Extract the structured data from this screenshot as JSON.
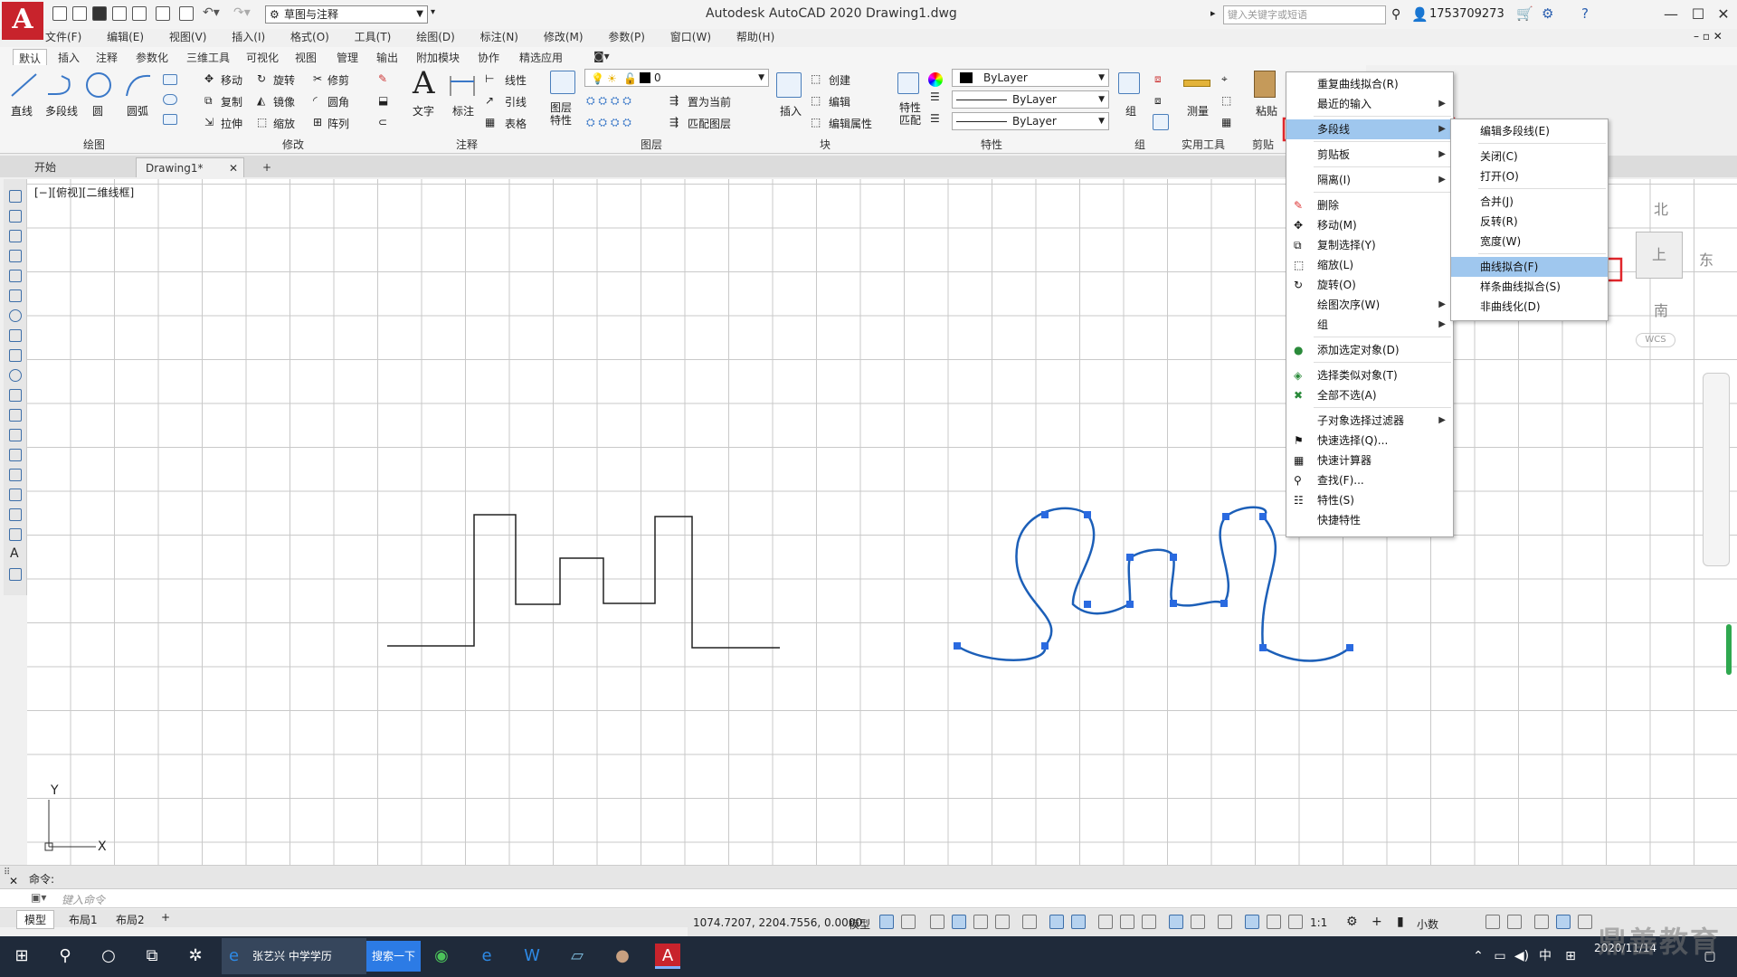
{
  "titlebar": {
    "logo": "A",
    "workspace": "草图与注释",
    "title": "Autodesk AutoCAD 2020    Drawing1.dwg",
    "search_placeholder": "键入关键字或短语",
    "user": "1753709273",
    "minimize": "—",
    "restore": "☐",
    "close": "✕"
  },
  "menubar": [
    "文件(F)",
    "编辑(E)",
    "视图(V)",
    "插入(I)",
    "格式(O)",
    "工具(T)",
    "绘图(D)",
    "标注(N)",
    "修改(M)",
    "参数(P)",
    "窗口(W)",
    "帮助(H)"
  ],
  "ribbon_tabs": [
    "默认",
    "插入",
    "注释",
    "参数化",
    "三维工具",
    "可视化",
    "视图",
    "管理",
    "输出",
    "附加模块",
    "协作",
    "精选应用"
  ],
  "ribbon": {
    "draw": {
      "title": "绘图",
      "line": "直线",
      "polyline": "多段线",
      "circle": "圆",
      "arc": "圆弧"
    },
    "modify": {
      "title": "修改",
      "move": "移动",
      "rotate": "旋转",
      "trim": "修剪",
      "copy": "复制",
      "mirror": "镜像",
      "fillet": "圆角",
      "stretch": "拉伸",
      "scale": "缩放",
      "array": "阵列"
    },
    "annotation": {
      "title": "注释",
      "text": "文字",
      "dimension": "标注",
      "linear": "线性",
      "leader": "引线",
      "table": "表格"
    },
    "layers": {
      "title": "图层",
      "layer_props": "图层\n特性",
      "layer_name": "0",
      "set_current": "置为当前",
      "match_layer": "匹配图层"
    },
    "block": {
      "title": "块",
      "insert": "插入",
      "create": "创建",
      "edit": "编辑",
      "edit_attr": "编辑属性"
    },
    "properties": {
      "title": "特性",
      "match": "特性\n匹配",
      "color": "ByLayer",
      "linetype": "ByLayer",
      "lineweight": "ByLayer"
    },
    "groups": {
      "title": "组",
      "group": "组"
    },
    "utilities": {
      "title": "实用工具",
      "measure": "测量"
    },
    "clipboard": {
      "title": "剪贴",
      "paste": "粘贴"
    }
  },
  "file_tabs": {
    "start": "开始",
    "drawing": "Drawing1*",
    "close": "✕",
    "add": "+"
  },
  "viewport_label": "[−][俯视][二维线框]",
  "ucs": {
    "y": "Y",
    "x": "X"
  },
  "viewcube": {
    "north": "北",
    "east": "东",
    "south": "南",
    "top": "上",
    "wcs": "WCS"
  },
  "context_menu": {
    "items": [
      {
        "label": "重复曲线拟合(R)"
      },
      {
        "label": "最近的输入",
        "sub": true
      },
      {
        "label": "多段线",
        "sub": true,
        "highlight": true
      },
      {
        "label": "剪贴板",
        "sub": true
      },
      {
        "label": "隔离(I)",
        "sub": true
      },
      {
        "label": "删除"
      },
      {
        "label": "移动(M)"
      },
      {
        "label": "复制选择(Y)"
      },
      {
        "label": "缩放(L)"
      },
      {
        "label": "旋转(O)"
      },
      {
        "label": "绘图次序(W)",
        "sub": true
      },
      {
        "label": "组",
        "sub": true
      },
      {
        "label": "添加选定对象(D)"
      },
      {
        "label": "选择类似对象(T)"
      },
      {
        "label": "全部不选(A)"
      },
      {
        "label": "子对象选择过滤器",
        "sub": true
      },
      {
        "label": "快速选择(Q)..."
      },
      {
        "label": "快速计算器"
      },
      {
        "label": "查找(F)..."
      },
      {
        "label": "特性(S)"
      },
      {
        "label": "快捷特性"
      }
    ]
  },
  "submenu": {
    "items": [
      {
        "label": "编辑多段线(E)"
      },
      {
        "label": "关闭(C)"
      },
      {
        "label": "打开(O)"
      },
      {
        "label": "合并(J)"
      },
      {
        "label": "反转(R)"
      },
      {
        "label": "宽度(W)"
      },
      {
        "label": "曲线拟合(F)",
        "highlight": true
      },
      {
        "label": "样条曲线拟合(S)"
      },
      {
        "label": "非曲线化(D)"
      }
    ]
  },
  "command": {
    "history": "命令:",
    "placeholder": "键入命令"
  },
  "layout_tabs": [
    "模型",
    "布局1",
    "布局2",
    "+"
  ],
  "status": {
    "coords": "1074.7207, 2204.7556, 0.0000",
    "model": "模型",
    "scale": "1:1",
    "units": "小数"
  },
  "taskbar": {
    "browser": "张艺兴 中学学历",
    "search_btn": "搜索一下",
    "time": "",
    "date": "2020/11/14"
  },
  "watermark": "鼎善教育",
  "colors": {
    "accent": "#3a78c8",
    "highlight": "#9fc7ee",
    "annotation_red": "#e0262b",
    "selected_curve": "#1c5fb8",
    "grip": "#2a6ae0"
  }
}
